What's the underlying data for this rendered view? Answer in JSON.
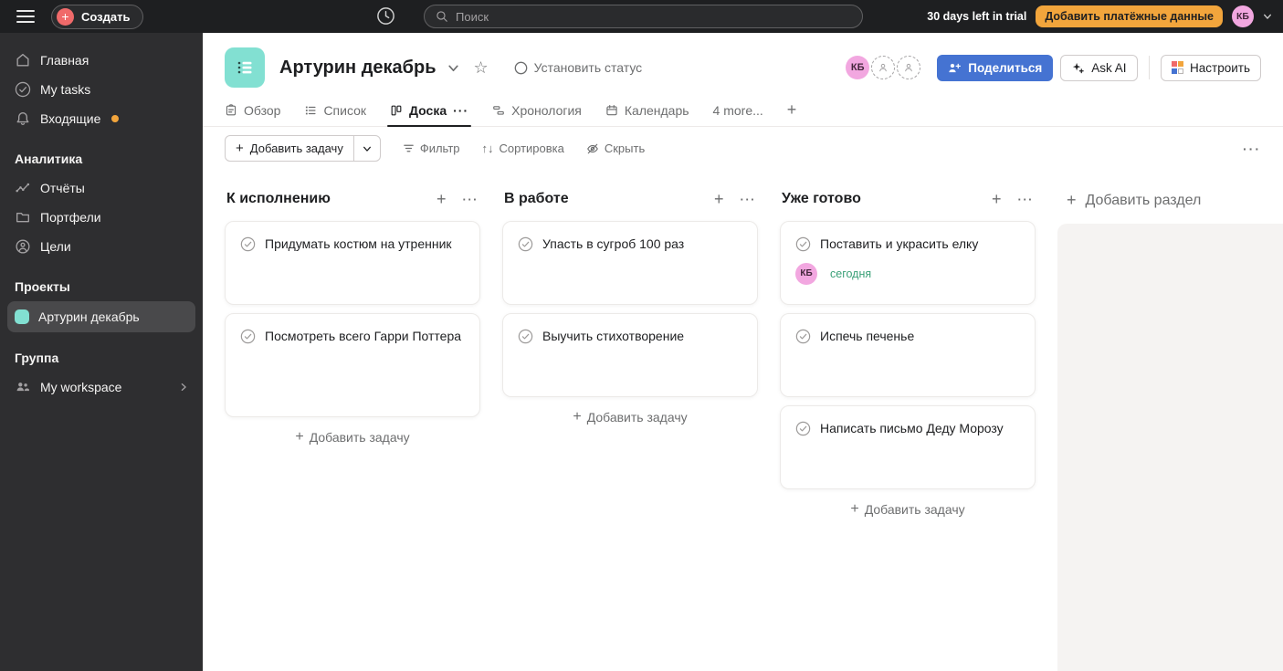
{
  "topbar": {
    "create_label": "Создать",
    "search_placeholder": "Поиск",
    "trial_text": "30 days left in trial",
    "billing_label": "Добавить платёжные данные",
    "avatar_initials": "КБ"
  },
  "sidebar": {
    "items": [
      {
        "label": "Главная"
      },
      {
        "label": "My tasks"
      },
      {
        "label": "Входящие"
      }
    ],
    "sections": [
      {
        "title": "Аналитика",
        "items": [
          {
            "label": "Отчёты"
          },
          {
            "label": "Портфели"
          },
          {
            "label": "Цели"
          }
        ]
      },
      {
        "title": "Проекты",
        "items": [
          {
            "label": "Артурин декабрь"
          }
        ]
      },
      {
        "title": "Группа",
        "items": [
          {
            "label": "My workspace"
          }
        ]
      }
    ]
  },
  "header": {
    "title": "Артурин декабрь",
    "set_status_label": "Установить статус",
    "share_label": "Поделиться",
    "ask_ai_label": "Ask AI",
    "customize_label": "Настроить",
    "avatar_initials": "КБ"
  },
  "tabs": {
    "items": [
      {
        "label": "Обзор"
      },
      {
        "label": "Список"
      },
      {
        "label": "Доска",
        "active": true
      },
      {
        "label": "Хронология"
      },
      {
        "label": "Календарь"
      }
    ],
    "more_label": "4 more..."
  },
  "toolbar": {
    "add_task_label": "Добавить задачу",
    "filter_label": "Фильтр",
    "sort_label": "Сортировка",
    "hide_label": "Скрыть"
  },
  "board": {
    "columns": [
      {
        "title": "К исполнению",
        "cards": [
          {
            "title": "Придумать костюм на утренник"
          },
          {
            "title": "Посмотреть всего Гарри Поттера"
          }
        ],
        "add_task_label": "Добавить задачу"
      },
      {
        "title": "В работе",
        "cards": [
          {
            "title": "Упасть в сугроб 100 раз"
          },
          {
            "title": "Выучить стихотворение"
          }
        ],
        "add_task_label": "Добавить задачу"
      },
      {
        "title": "Уже готово",
        "cards": [
          {
            "title": "Поставить и украсить елку",
            "assignee_initials": "КБ",
            "due_date": "сегодня"
          },
          {
            "title": "Испечь печенье"
          },
          {
            "title": "Написать письмо Деду Морозу"
          }
        ],
        "add_task_label": "Добавить задачу"
      }
    ],
    "add_section_label": "Добавить раздел"
  },
  "icons": {
    "overflow_glyph": "···",
    "plus_glyph": "+",
    "star_glyph": "☆",
    "sort_glyph": "↑↓"
  },
  "colors": {
    "topbar_bg": "#1e1f21",
    "sidebar_bg": "#2e2e30",
    "accent_blue": "#4573d2",
    "brand_red": "#f06a6a",
    "trial_orange": "#f2a53c",
    "project_teal": "#82e0d2",
    "avatar_pink": "#f2a7e0",
    "due_today_green": "#3aa077"
  }
}
